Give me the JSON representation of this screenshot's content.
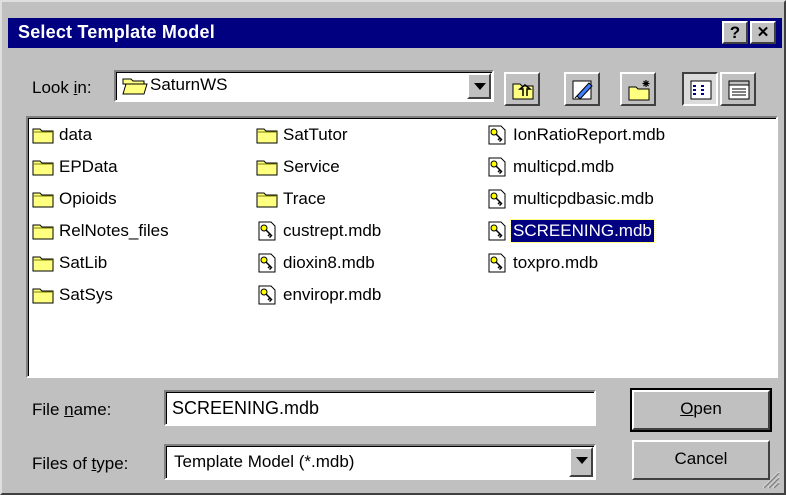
{
  "window": {
    "title": "Select Template Model",
    "help_button": "?",
    "close_button": "✕"
  },
  "look_in": {
    "label_prefix": "Look ",
    "label_hotkey": "i",
    "label_suffix": "n:",
    "value": "SaturnWS"
  },
  "files": [
    {
      "name": "data",
      "type": "folder"
    },
    {
      "name": "EPData",
      "type": "folder"
    },
    {
      "name": "Opioids",
      "type": "folder"
    },
    {
      "name": "RelNotes_files",
      "type": "folder"
    },
    {
      "name": "SatLib",
      "type": "folder"
    },
    {
      "name": "SatSys",
      "type": "folder"
    },
    {
      "name": "SatTutor",
      "type": "folder"
    },
    {
      "name": "Service",
      "type": "folder"
    },
    {
      "name": "Trace",
      "type": "folder"
    },
    {
      "name": "custrept.mdb",
      "type": "mdb"
    },
    {
      "name": "dioxin8.mdb",
      "type": "mdb"
    },
    {
      "name": "enviropr.mdb",
      "type": "mdb"
    },
    {
      "name": "IonRatioReport.mdb",
      "type": "mdb"
    },
    {
      "name": "multicpd.mdb",
      "type": "mdb"
    },
    {
      "name": "multicpdbasic.mdb",
      "type": "mdb"
    },
    {
      "name": "SCREENING.mdb",
      "type": "mdb",
      "selected": true
    },
    {
      "name": "toxpro.mdb",
      "type": "mdb"
    }
  ],
  "file_name": {
    "label_prefix": "File ",
    "label_hotkey": "n",
    "label_suffix": "ame:",
    "value": "SCREENING.mdb"
  },
  "file_type": {
    "label_prefix": "Files of ",
    "label_hotkey": "t",
    "label_suffix": "ype:",
    "value": "Template Model (*.mdb)"
  },
  "buttons": {
    "open_hotkey": "O",
    "open_rest": "pen",
    "cancel": "Cancel"
  },
  "colors": {
    "title_bar": "#000080",
    "face": "#c0c0c0",
    "selection": "#000080",
    "folder": "#ffff80"
  }
}
